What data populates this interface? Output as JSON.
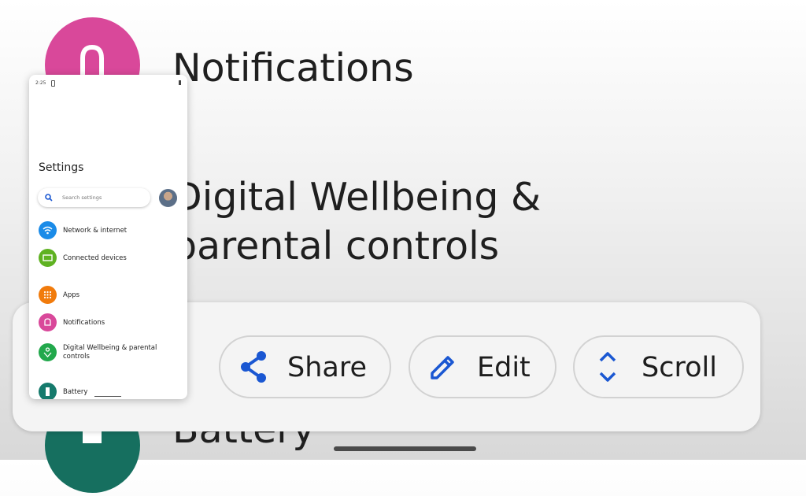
{
  "background": {
    "items": [
      {
        "label": "Notifications",
        "icon": "bell-icon",
        "color": "#d9489a"
      },
      {
        "label": "Digital Wellbeing & parental controls",
        "icon": "wellbeing-icon",
        "color": "#1e8e3e"
      },
      {
        "label": "Battery",
        "icon": "battery-icon",
        "color": "#166f5f"
      }
    ]
  },
  "actions": [
    {
      "label": "Share",
      "icon": "share-icon"
    },
    {
      "label": "Edit",
      "icon": "edit-icon"
    },
    {
      "label": "Scroll",
      "icon": "scroll-icon"
    }
  ],
  "accent_color": "#1a57d2",
  "preview": {
    "status_time": "2:25",
    "title": "Settings",
    "search_placeholder": "Search settings",
    "items": [
      {
        "label": "Network & internet",
        "icon": "wifi-icon",
        "color": "#1a8be8"
      },
      {
        "label": "Connected devices",
        "icon": "devices-icon",
        "color": "#5fb222"
      },
      {
        "label": "Apps",
        "icon": "apps-icon",
        "color": "#f17b0c"
      },
      {
        "label": "Notifications",
        "icon": "bell-icon",
        "color": "#d9489a"
      },
      {
        "label": "Digital Wellbeing & parental controls",
        "icon": "wellbeing-icon",
        "color": "#22a84c"
      },
      {
        "label": "Battery",
        "icon": "battery-icon",
        "color": "#157a6c"
      }
    ]
  }
}
